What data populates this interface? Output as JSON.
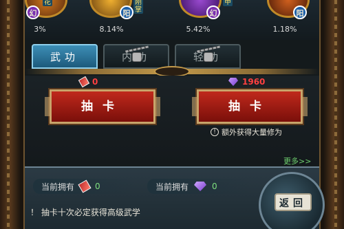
{
  "skills": [
    {
      "tag": "幻",
      "side": "花",
      "percent": "3%",
      "tag_color": "#7a2fb0",
      "orb_color": "#d27a1e"
    },
    {
      "tag": "阳",
      "side": "刚掌",
      "percent": "8.14%",
      "tag_color": "#1c5fa8",
      "orb_color": "#f0b030"
    },
    {
      "tag": "幻",
      "side": "甲",
      "percent": "5.42%",
      "tag_color": "#7a2fb0",
      "orb_color": "#9a4ad0"
    },
    {
      "tag": "阳",
      "side": "",
      "percent": "1.18%",
      "tag_color": "#1c5fa8",
      "orb_color": "#d0601e"
    }
  ],
  "tabs": [
    {
      "label": "武功",
      "locked": false
    },
    {
      "label": "内功",
      "locked": true
    },
    {
      "label": "轻功",
      "locked": true
    }
  ],
  "draw": {
    "left": {
      "cost": "0",
      "button_label": "抽卡"
    },
    "right": {
      "cost": "1960",
      "button_label": "抽卡",
      "note": "额外获得大量修为"
    },
    "more_link": "更多>>"
  },
  "bottom": {
    "own_label": "当前拥有",
    "own_scroll_value": "0",
    "own_gem_value": "0",
    "tip": "！ 抽卡十次必定获得高级武学",
    "back_label": "返回"
  }
}
